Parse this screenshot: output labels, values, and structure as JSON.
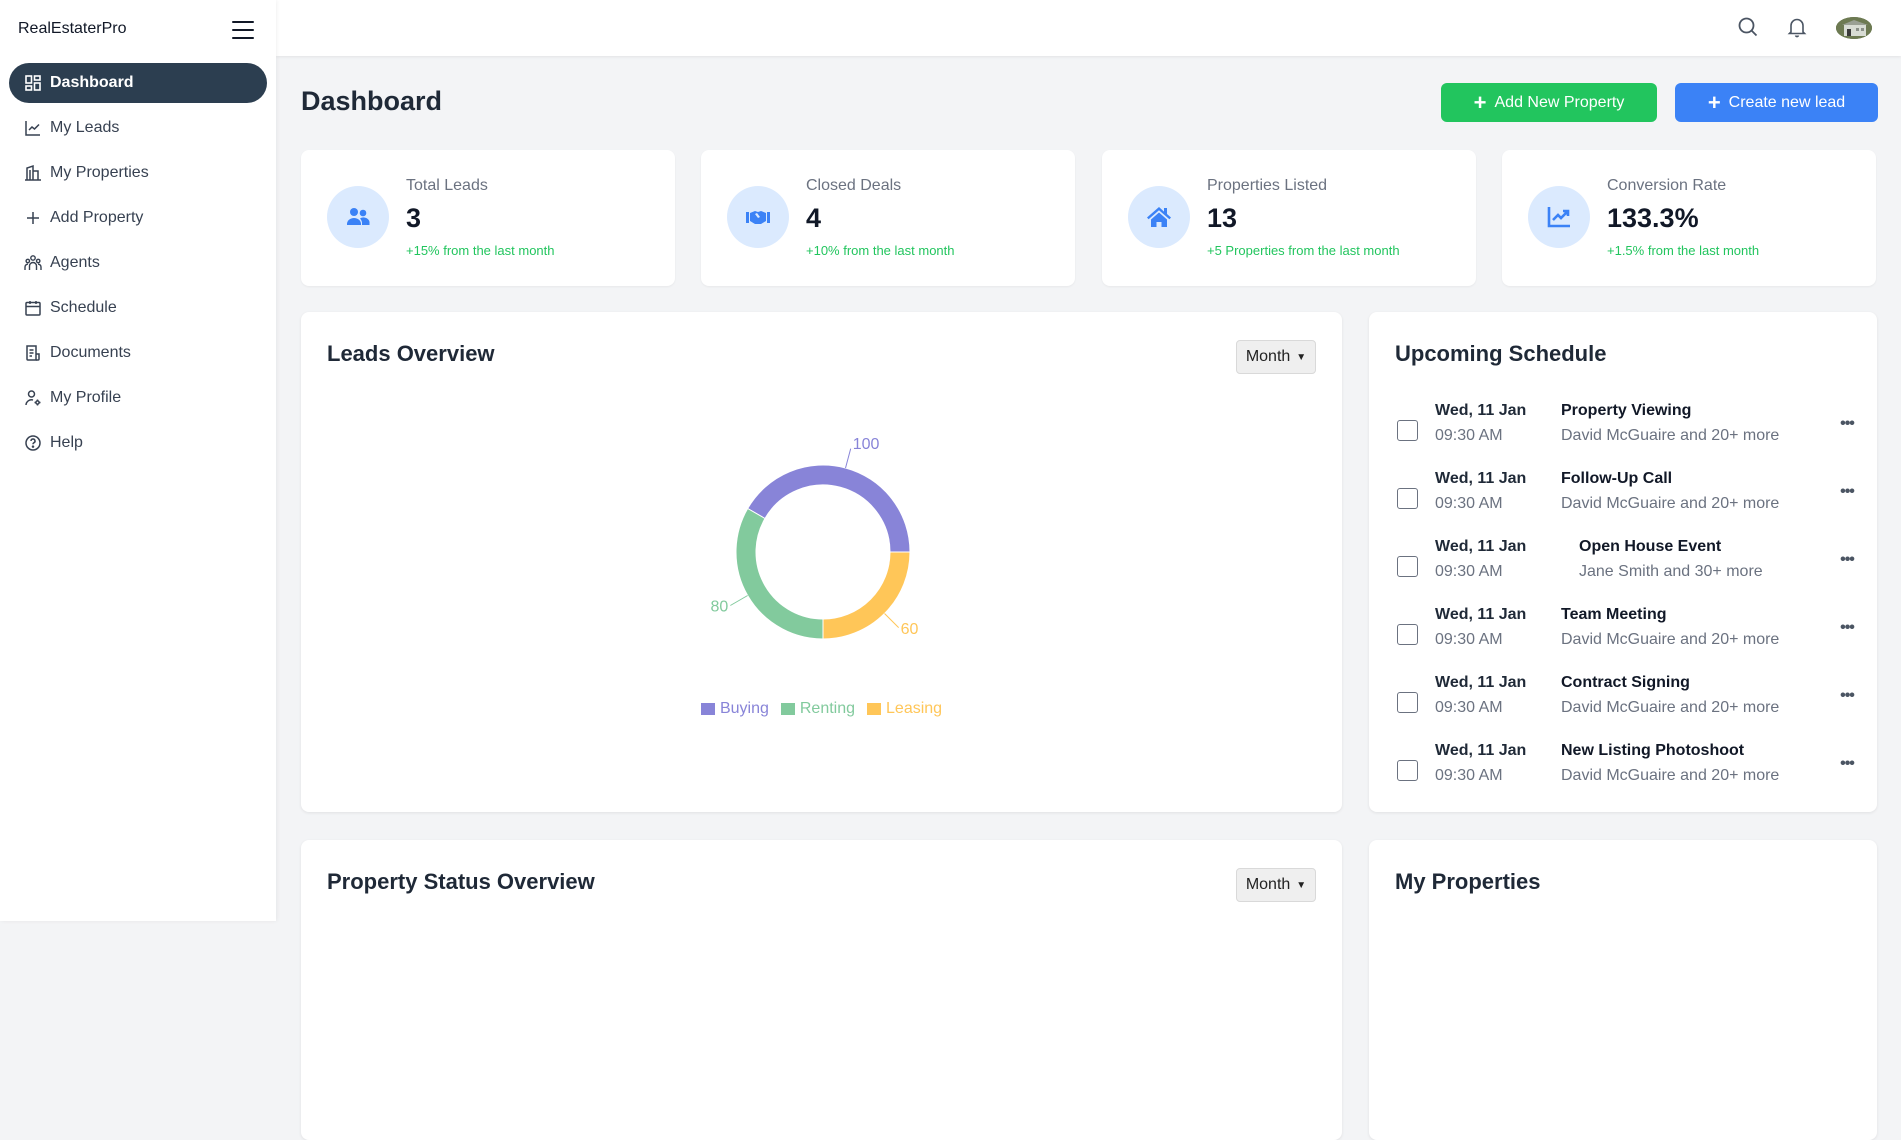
{
  "app": {
    "brand": "RealEstaterPro"
  },
  "sidebar": {
    "items": [
      {
        "label": "Dashboard",
        "icon": "dashboard-icon",
        "active": true
      },
      {
        "label": "My Leads",
        "icon": "chart-line-icon"
      },
      {
        "label": "My Properties",
        "icon": "building-icon"
      },
      {
        "label": "Add Property",
        "icon": "plus-icon"
      },
      {
        "label": "Agents",
        "icon": "users-icon"
      },
      {
        "label": "Schedule",
        "icon": "calendar-icon"
      },
      {
        "label": "Documents",
        "icon": "document-icon"
      },
      {
        "label": "My Profile",
        "icon": "user-gear-icon"
      },
      {
        "label": "Help",
        "icon": "help-circle-icon"
      }
    ]
  },
  "header": {
    "icons": [
      "search-icon",
      "bell-icon",
      "avatar"
    ]
  },
  "page": {
    "title": "Dashboard",
    "actions": {
      "add_property": "Add New Property",
      "create_lead": "Create new lead"
    }
  },
  "stats": [
    {
      "label": "Total Leads",
      "value": "3",
      "change": "+15% from the last month",
      "icon": "users-icon"
    },
    {
      "label": "Closed Deals",
      "value": "4",
      "change": "+10% from the last month",
      "icon": "handshake-icon"
    },
    {
      "label": "Properties Listed",
      "value": "13",
      "change": "+5 Properties from the last month",
      "icon": "house-icon"
    },
    {
      "label": "Conversion Rate",
      "value": "133.3%",
      "change": "+1.5% from the last month",
      "icon": "chart-up-icon"
    }
  ],
  "leads_overview": {
    "title": "Leads Overview",
    "period": "Month"
  },
  "chart_data": {
    "type": "pie",
    "variant": "donut",
    "title": "Leads Overview",
    "categories": [
      "Buying",
      "Renting",
      "Leasing"
    ],
    "values": [
      100,
      80,
      60
    ],
    "colors": [
      "#8884D8",
      "#82CA9D",
      "#FFC658"
    ],
    "legend": "bottom",
    "data_labels": true
  },
  "schedule": {
    "title": "Upcoming Schedule",
    "items": [
      {
        "date": "Wed, 11 Jan",
        "time": "09:30 AM",
        "title": "Property Viewing",
        "attendees": "David McGuaire and 20+ more",
        "checked": false
      },
      {
        "date": "Wed, 11 Jan",
        "time": "09:30 AM",
        "title": "Follow-Up Call",
        "attendees": "David McGuaire and 20+ more",
        "checked": false
      },
      {
        "date": "Wed, 11 Jan",
        "time": "09:30 AM",
        "title": "Open House Event",
        "attendees": "Jane Smith and 30+ more",
        "checked": false
      },
      {
        "date": "Wed, 11 Jan",
        "time": "09:30 AM",
        "title": "Team Meeting",
        "attendees": "David McGuaire and 20+ more",
        "checked": false
      },
      {
        "date": "Wed, 11 Jan",
        "time": "09:30 AM",
        "title": "Contract Signing",
        "attendees": "David McGuaire and 20+ more",
        "checked": false
      },
      {
        "date": "Wed, 11 Jan",
        "time": "09:30 AM",
        "title": "New Listing Photoshoot",
        "attendees": "David McGuaire and 20+ more",
        "checked": false
      }
    ],
    "more_label": "•••"
  },
  "property_status": {
    "title": "Property Status Overview",
    "period": "Month"
  },
  "my_properties": {
    "title": "My Properties"
  },
  "colors": {
    "sidebar_active": "#2C3E50",
    "primary_green": "#22C55E",
    "primary_blue": "#3B82F6",
    "icon_bg": "#DBEAFE",
    "positive_text": "#22C55E"
  }
}
